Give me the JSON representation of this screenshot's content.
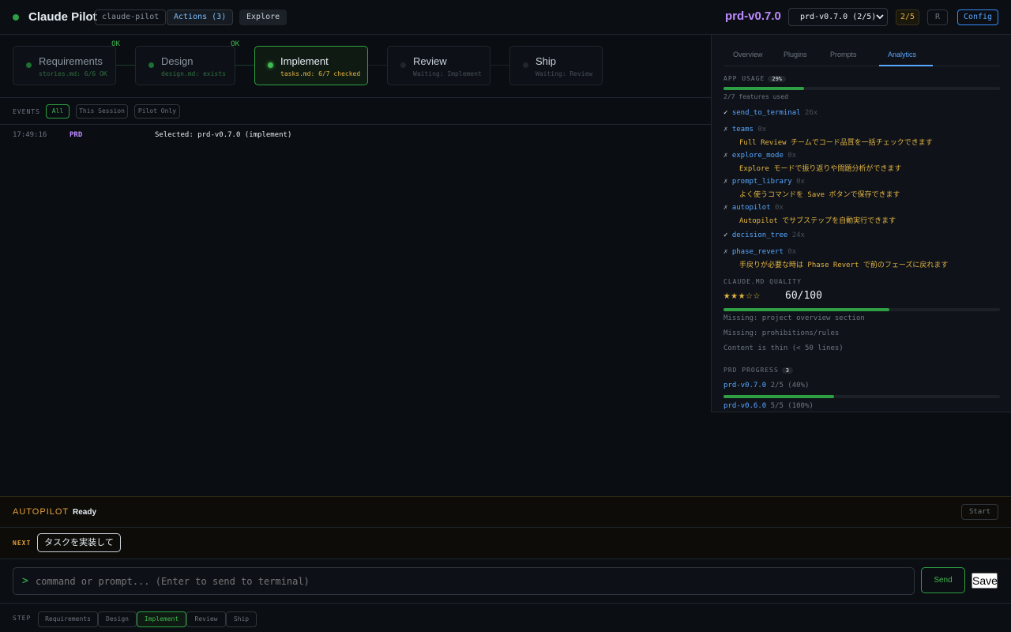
{
  "header": {
    "app_title": "Claude Pilot",
    "project_pill": "claude-pilot",
    "actions_pill": "Actions (3)",
    "explore_pill": "Explore",
    "prd_version": "prd-v0.7.0",
    "prd_select": "prd-v0.7.0 (2/5)",
    "progress_badge": "2/5",
    "r_button": "R",
    "config_button": "Config"
  },
  "phases": [
    {
      "name": "Requirements",
      "sub": "stories.md: 6/6 OK",
      "ok": "OK"
    },
    {
      "name": "Design",
      "sub": "design.md: exists",
      "ok": "OK"
    },
    {
      "name": "Implement",
      "sub": "tasks.md: 6/7 checked"
    },
    {
      "name": "Review",
      "sub": "Waiting: Implement"
    },
    {
      "name": "Ship",
      "sub": "Waiting: Review"
    }
  ],
  "events": {
    "label": "EVENTS",
    "filters": [
      "All",
      "This Session",
      "Pilot Only"
    ],
    "rows": [
      {
        "time": "17:49:16",
        "type": "PRD",
        "message": "Selected: prd-v0.7.0 (implement)"
      }
    ]
  },
  "panel": {
    "tabs": [
      "Overview",
      "Plugins",
      "Prompts",
      "Analytics"
    ],
    "app_usage_label": "APP USAGE",
    "app_usage_badge": "29%",
    "app_usage_fraction": 0.29,
    "features_used": "2/7 features used",
    "features": [
      {
        "mark": "✓",
        "name": "send_to_terminal",
        "count": "26x",
        "hint": ""
      },
      {
        "mark": "✗",
        "name": "teams",
        "count": "0x",
        "hint": "Full Review チームでコード品質を一括チェックできます"
      },
      {
        "mark": "✗",
        "name": "explore_mode",
        "count": "0x",
        "hint": "Explore モードで振り返りや問題分析ができます"
      },
      {
        "mark": "✗",
        "name": "prompt_library",
        "count": "0x",
        "hint": "よく使うコマンドを Save ボタンで保存できます"
      },
      {
        "mark": "✗",
        "name": "autopilot",
        "count": "0x",
        "hint": "Autopilot でサブステップを自動実行できます"
      },
      {
        "mark": "✓",
        "name": "decision_tree",
        "count": "24x",
        "hint": ""
      },
      {
        "mark": "✗",
        "name": "phase_revert",
        "count": "0x",
        "hint": "手戻りが必要な時は Phase Revert で前のフェーズに戻れます"
      }
    ],
    "quality_label": "CLAUDE.MD QUALITY",
    "stars": "★★★☆☆",
    "score": "60/100",
    "score_fraction": 0.6,
    "missing": [
      "Missing: project overview section",
      "Missing: prohibitions/rules",
      "Content is thin (< 50 lines)"
    ],
    "prd_progress_label": "PRD PROGRESS",
    "prd_progress_badge": "3",
    "prds": [
      {
        "name": "prd-v0.7.0",
        "status": "2/5 (40%)",
        "fraction": 0.4
      },
      {
        "name": "prd-v0.6.0",
        "status": "5/5 (100%)",
        "fraction": 1.0
      }
    ]
  },
  "autopilot": {
    "label": "AUTOPILOT",
    "status": "Ready",
    "start_button": "Start"
  },
  "next": {
    "label": "NEXT",
    "task_button": "タスクを実装して"
  },
  "command": {
    "prompt": ">",
    "placeholder": "command or prompt... (Enter to send to terminal)",
    "send_button": "Send",
    "save_button": "Save"
  },
  "step": {
    "label": "STEP",
    "buttons": [
      "Requirements",
      "Design",
      "Implement",
      "Review",
      "Ship"
    ]
  },
  "colors": {
    "accent_green": "#3fb950",
    "link_blue": "#58a6ff",
    "prd_purple": "#bc8cff",
    "hint_yellow": "#e3b341"
  }
}
